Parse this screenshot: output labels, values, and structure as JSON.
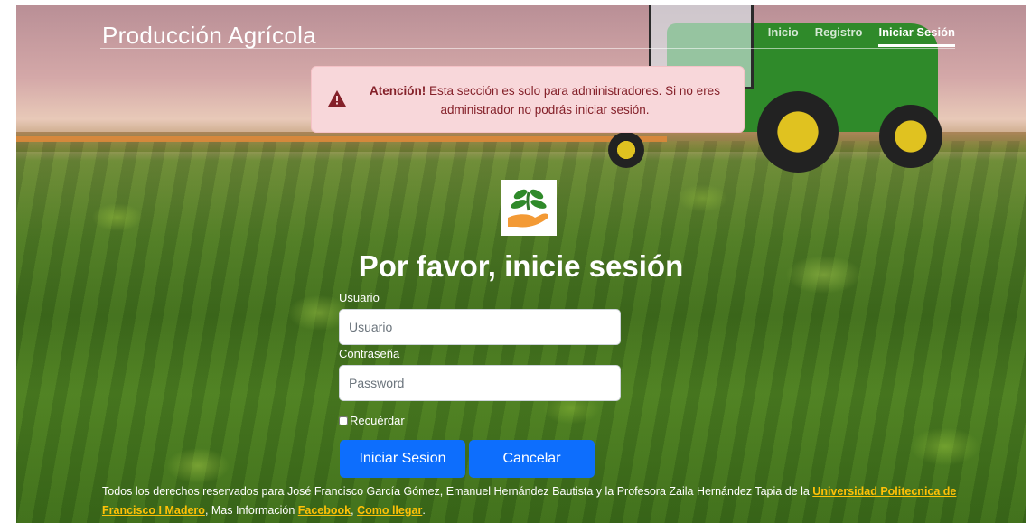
{
  "header": {
    "brand": "Producción Agrícola",
    "nav": [
      {
        "label": "Inicio"
      },
      {
        "label": "Registro"
      },
      {
        "label": "Iniciar Sesión"
      }
    ]
  },
  "alert": {
    "strong": "Atención!",
    "message": " Esta sección es solo para administradores. Si no eres administrador no podrás iniciar sesión."
  },
  "login": {
    "title": "Por favor, inicie sesión",
    "username_label": "Usuario",
    "username_placeholder": "Usuario",
    "password_label": "Contraseña",
    "password_placeholder": "Password",
    "remember_label": "Recuérdar",
    "submit_label": "Iniciar Sesion",
    "cancel_label": "Cancelar"
  },
  "footer": {
    "text": "Todos los derechos reservados para José Francisco García Gómez, Emanuel Hernández Bautista y la Profesora Zaila Hernández Tapia de la ",
    "university_link": "Universidad Politecnica de Francisco I Madero",
    "more_info": ", Mas Información ",
    "facebook_link": "Facebook",
    "sep": ", ",
    "directions_link": "Como llegar",
    "end": "."
  },
  "colors": {
    "primary": "#0d6efd",
    "alert_bg": "#f8d7da",
    "alert_text": "#842029",
    "link": "#ffc107"
  },
  "icons": [
    "warning-triangle-icon",
    "plant-hand-logo"
  ]
}
